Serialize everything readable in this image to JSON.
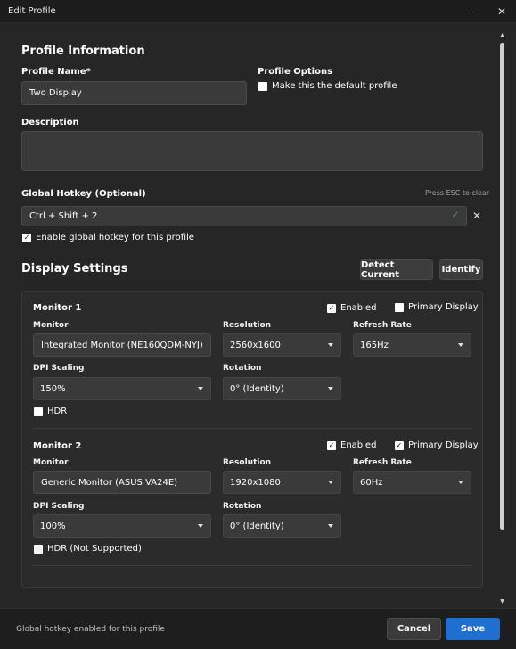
{
  "window": {
    "title": "Edit Profile",
    "minimize_glyph": "—",
    "close_glyph": "✕"
  },
  "profile_info": {
    "heading": "Profile Information",
    "name_label": "Profile Name*",
    "name_value": "Two Display",
    "options_label": "Profile Options",
    "default_checkbox_label": "Make this the default profile",
    "default_checked": false,
    "description_label": "Description",
    "description_value": ""
  },
  "hotkey": {
    "label": "Global Hotkey (Optional)",
    "hint": "Press ESC to clear",
    "value": "Ctrl + Shift + 2",
    "valid_glyph": "✓",
    "clear_glyph": "✕",
    "enable_label": "Enable global hotkey for this profile",
    "enable_checked": true
  },
  "display_settings": {
    "heading": "Display Settings",
    "detect_button": "Detect Current",
    "identify_button": "Identify",
    "monitors": [
      {
        "title": "Monitor 1",
        "enabled_label": "Enabled",
        "enabled_checked": true,
        "primary_label": "Primary Display",
        "primary_checked": false,
        "monitor_label": "Monitor",
        "monitor_value": "Integrated Monitor (NE160QDM-NYJ)",
        "resolution_label": "Resolution",
        "resolution_value": "2560x1600",
        "refresh_label": "Refresh Rate",
        "refresh_value": "165Hz",
        "dpi_label": "DPI Scaling",
        "dpi_value": "150%",
        "rotation_label": "Rotation",
        "rotation_value": "0° (Identity)",
        "hdr_label": "HDR",
        "hdr_checked": false
      },
      {
        "title": "Monitor 2",
        "enabled_label": "Enabled",
        "enabled_checked": true,
        "primary_label": "Primary Display",
        "primary_checked": true,
        "monitor_label": "Monitor",
        "monitor_value": "Generic Monitor (ASUS VA24E)",
        "resolution_label": "Resolution",
        "resolution_value": "1920x1080",
        "refresh_label": "Refresh Rate",
        "refresh_value": "60Hz",
        "dpi_label": "DPI Scaling",
        "dpi_value": "100%",
        "rotation_label": "Rotation",
        "rotation_value": "0° (Identity)",
        "hdr_label": "HDR (Not Supported)",
        "hdr_checked": false
      }
    ]
  },
  "footer": {
    "status": "Global hotkey enabled for this profile",
    "cancel_label": "Cancel",
    "save_label": "Save"
  },
  "colors": {
    "accent": "#1f6fd0",
    "valid": "#3fa34d",
    "background": "#262626"
  }
}
